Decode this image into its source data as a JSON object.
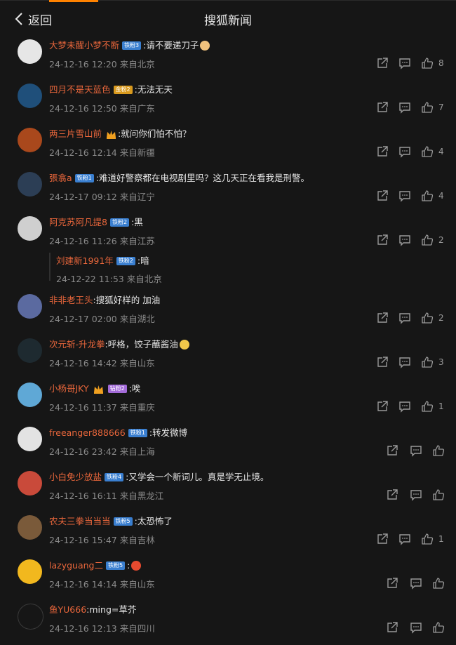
{
  "header": {
    "back_label": "返回",
    "title": "搜狐新闻"
  },
  "comments": [
    {
      "name": "大梦未醒小梦不断",
      "badge": "铁粉3",
      "badge_color": "#3a7fd0",
      "text": ":请不要递刀子",
      "emoji": "cat-face",
      "emoji_color": "#f1c27d",
      "meta": "24-12-16 12:20 来自北京",
      "likes": "8",
      "avatar_color": "#e6e6e6"
    },
    {
      "name": "四月不是天蓝色",
      "badge": "金粉2",
      "badge_color": "#d99a1e",
      "text": ":无法无天",
      "meta": "24-12-16 12:50 来自广东",
      "likes": "7",
      "avatar_color": "#1f4f7a"
    },
    {
      "name": "两三片雪山前",
      "crown": true,
      "text": ":就问你们怕不怕？",
      "meta": "24-12-16 12:14 来自新疆",
      "likes": "4",
      "avatar_color": "#a9481c"
    },
    {
      "name": "張翕a",
      "badge": "铁粉1",
      "badge_color": "#3a7fd0",
      "text": ":难道好警察都在电视剧里吗？这几天正在看我是刑警。",
      "meta": "24-12-17 09:12 来自辽宁",
      "likes": "4",
      "avatar_color": "#2c3e55"
    },
    {
      "name": "阿克苏阿凡提8",
      "badge": "铁粉2",
      "badge_color": "#3a7fd0",
      "text": ":黑",
      "meta": "24-12-16 11:26 来自江苏",
      "likes": "2",
      "avatar_color": "#cfcfcf",
      "reply": {
        "name": "刘建新1991年",
        "badge": "铁粉2",
        "text": ":暗",
        "meta": "24-12-22 11:53 来自北京"
      }
    },
    {
      "name": "非非老王头",
      "text": ":搜狐好样的  加油",
      "meta": "24-12-17 02:00 来自湖北",
      "likes": "2",
      "avatar_color": "#5b6aa0"
    },
    {
      "name": "次元斩-升龙拳",
      "text": ":呼格，饺子蘸酱油",
      "emoji": "face-emoji",
      "emoji_color": "#f1c84a",
      "meta": "24-12-16 14:42 来自山东",
      "likes": "3",
      "avatar_color": "#1e2a30"
    },
    {
      "name": "小杨哥JKY",
      "crown": true,
      "badge": "钻粉2",
      "badge_color": "#a36bd9",
      "text": ":唉",
      "meta": "24-12-16 11:37 来自重庆",
      "likes": "1",
      "avatar_color": "#5fa8d6"
    },
    {
      "name": "freeanger888666",
      "badge": "铁粉1",
      "badge_color": "#3a7fd0",
      "text": ":转发微博",
      "meta": "24-12-16 23:42 来自上海",
      "likes": "",
      "avatar_color": "#e3e3e3"
    },
    {
      "name": "小白免少放盐",
      "badge": "铁粉4",
      "badge_color": "#3a7fd0",
      "text": ":又学会一个新词儿。真是学无止境。",
      "meta": "24-12-16 16:11 来自黑龙江",
      "likes": "",
      "avatar_color": "#c94a3a"
    },
    {
      "name": "农夫三拳当当当",
      "badge": "铁粉5",
      "badge_color": "#3a7fd0",
      "text": ":太恐怖了",
      "meta": "24-12-16 15:47 来自吉林",
      "likes": "1",
      "avatar_color": "#7a5a3a"
    },
    {
      "name": "lazyguang二",
      "badge": "铁粉5",
      "badge_color": "#3a7fd0",
      "text": ":",
      "emoji": "fries-emoji",
      "emoji_color": "#e84a2f",
      "meta": "24-12-16 14:14 来自山东",
      "likes": "",
      "avatar_color": "#f2b81e"
    },
    {
      "name": "鱼YU666",
      "text": ":ming=草芥",
      "meta": "24-12-16 12:13 来自四川",
      "likes": "",
      "avatar_color": "#161616"
    }
  ]
}
